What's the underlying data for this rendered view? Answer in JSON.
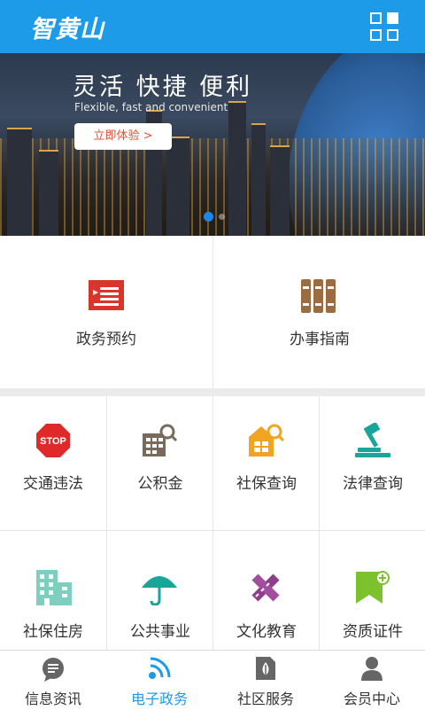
{
  "header": {
    "logo": "智黄山",
    "menu_icon": "grid-icon"
  },
  "banner": {
    "title": "灵活  快捷  便利",
    "subtitle": "Flexible, fast and convenient",
    "button": "立即体验 >",
    "active_slide": 1,
    "slide_count": 2
  },
  "services_main": [
    {
      "label": "政务预约",
      "icon": "appointment-icon"
    },
    {
      "label": "办事指南",
      "icon": "guide-books-icon"
    }
  ],
  "services_grid": [
    {
      "label": "交通违法",
      "icon": "stop-sign-icon"
    },
    {
      "label": "公积金",
      "icon": "fund-search-icon"
    },
    {
      "label": "社保查询",
      "icon": "social-security-search-icon"
    },
    {
      "label": "法律查询",
      "icon": "gavel-icon"
    },
    {
      "label": "社保住房",
      "icon": "building-icon"
    },
    {
      "label": "公共事业",
      "icon": "umbrella-icon"
    },
    {
      "label": "文化教育",
      "icon": "pencil-ruler-icon"
    },
    {
      "label": "资质证件",
      "icon": "bookmark-plus-icon"
    }
  ],
  "tabbar": {
    "active": 1,
    "tabs": [
      {
        "label": "信息资讯",
        "icon": "chat-bubble-icon"
      },
      {
        "label": "电子政务",
        "icon": "signal-icon"
      },
      {
        "label": "社区服务",
        "icon": "leaf-doc-icon"
      },
      {
        "label": "会员中心",
        "icon": "user-icon"
      }
    ]
  },
  "colors": {
    "header_bg": "#1e9be8",
    "accent": "#1e9be8",
    "appointment": "#d9362b",
    "guide": "#9c6b3f",
    "stop": "#e02a2a",
    "fund": "#7a6a5c",
    "social": "#f0a420",
    "law": "#1aa59a",
    "building": "#7ecfbf",
    "umbrella": "#1aa59a",
    "culture": "#8e3d8a",
    "cert": "#7cc22c"
  }
}
